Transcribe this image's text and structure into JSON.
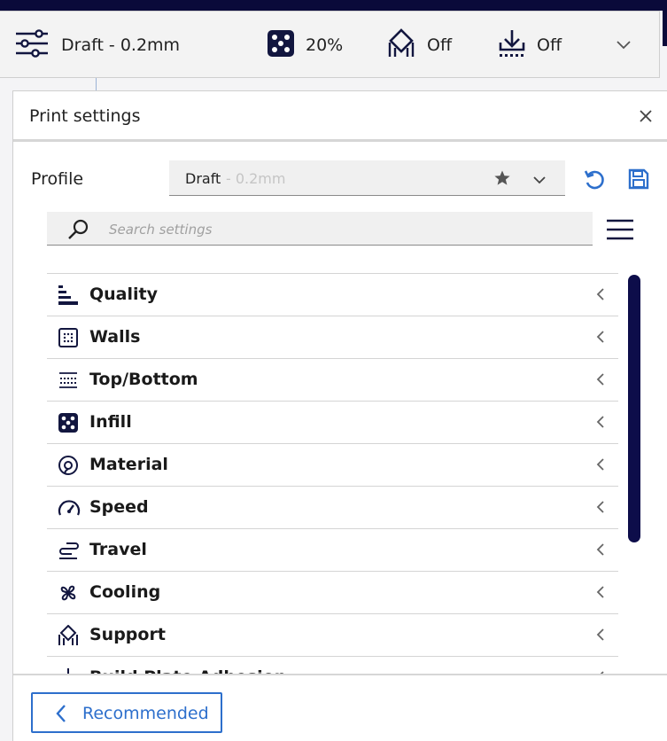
{
  "toolbar": {
    "profile": "Draft - 0.2mm",
    "infill": "20%",
    "support": "Off",
    "adhesion": "Off"
  },
  "panel": {
    "title": "Print settings",
    "profile_label": "Profile",
    "profile_name": "Draft",
    "profile_detail": " - 0.2mm",
    "search_placeholder": "Search settings",
    "recommended_label": "Recommended"
  },
  "categories": [
    {
      "label": "Quality",
      "icon": "quality-icon"
    },
    {
      "label": "Walls",
      "icon": "walls-icon"
    },
    {
      "label": "Top/Bottom",
      "icon": "top-bottom-icon"
    },
    {
      "label": "Infill",
      "icon": "infill-icon"
    },
    {
      "label": "Material",
      "icon": "material-icon"
    },
    {
      "label": "Speed",
      "icon": "speed-icon"
    },
    {
      "label": "Travel",
      "icon": "travel-icon"
    },
    {
      "label": "Cooling",
      "icon": "cooling-icon"
    },
    {
      "label": "Support",
      "icon": "support-icon"
    },
    {
      "label": "Build Plate Adhesion",
      "icon": "adhesion-icon"
    }
  ],
  "colors": {
    "accent": "#2d6fcc",
    "scrollbar": "#0d0d4a",
    "header_bar": "#0a0a3a"
  }
}
